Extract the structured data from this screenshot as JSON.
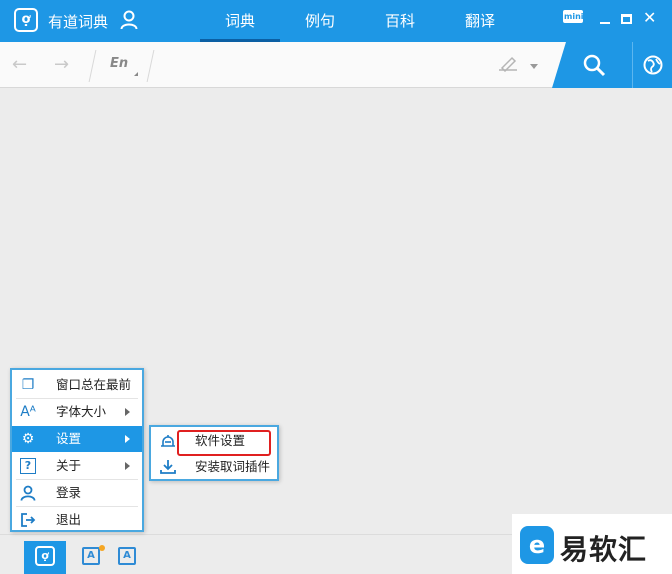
{
  "app": {
    "logo_char": "ợ",
    "title": "有道词典"
  },
  "tabs": [
    {
      "label": "词典",
      "active": true
    },
    {
      "label": "例句",
      "active": false
    },
    {
      "label": "百科",
      "active": false
    },
    {
      "label": "翻译",
      "active": false
    }
  ],
  "window_controls": {
    "mini_label": "mini",
    "close_glyph": "✕"
  },
  "toolbar": {
    "lang_label": "En",
    "search_placeholder": ""
  },
  "menu": {
    "items": [
      {
        "label": "窗口总在最前",
        "icon": "window-icon",
        "glyph": "❐",
        "has_submenu": false
      },
      {
        "label": "字体大小",
        "icon": "font-size-icon",
        "glyph": "Aᴬ",
        "has_submenu": true
      },
      {
        "label": "设置",
        "icon": "gear-icon",
        "glyph": "⚙",
        "has_submenu": true,
        "highlighted": true
      },
      {
        "label": "关于",
        "icon": "help-icon",
        "glyph": "?",
        "has_submenu": true
      },
      {
        "label": "登录",
        "icon": "user-icon",
        "glyph": "👤",
        "has_submenu": false
      },
      {
        "label": "退出",
        "icon": "exit-icon",
        "glyph": "⇥",
        "has_submenu": false
      }
    ]
  },
  "submenu": {
    "items": [
      {
        "label": "软件设置",
        "icon": "settings-scale-icon"
      },
      {
        "label": "安装取词插件",
        "icon": "download-icon"
      }
    ]
  },
  "bottombar": {
    "logo_char": "ợ",
    "icon_a": "A",
    "icon_b": "A"
  },
  "watermark": {
    "logo_char": "e",
    "text": "易软汇"
  },
  "colors": {
    "accent": "#1e97e5",
    "highlight_box": "#e02020"
  }
}
